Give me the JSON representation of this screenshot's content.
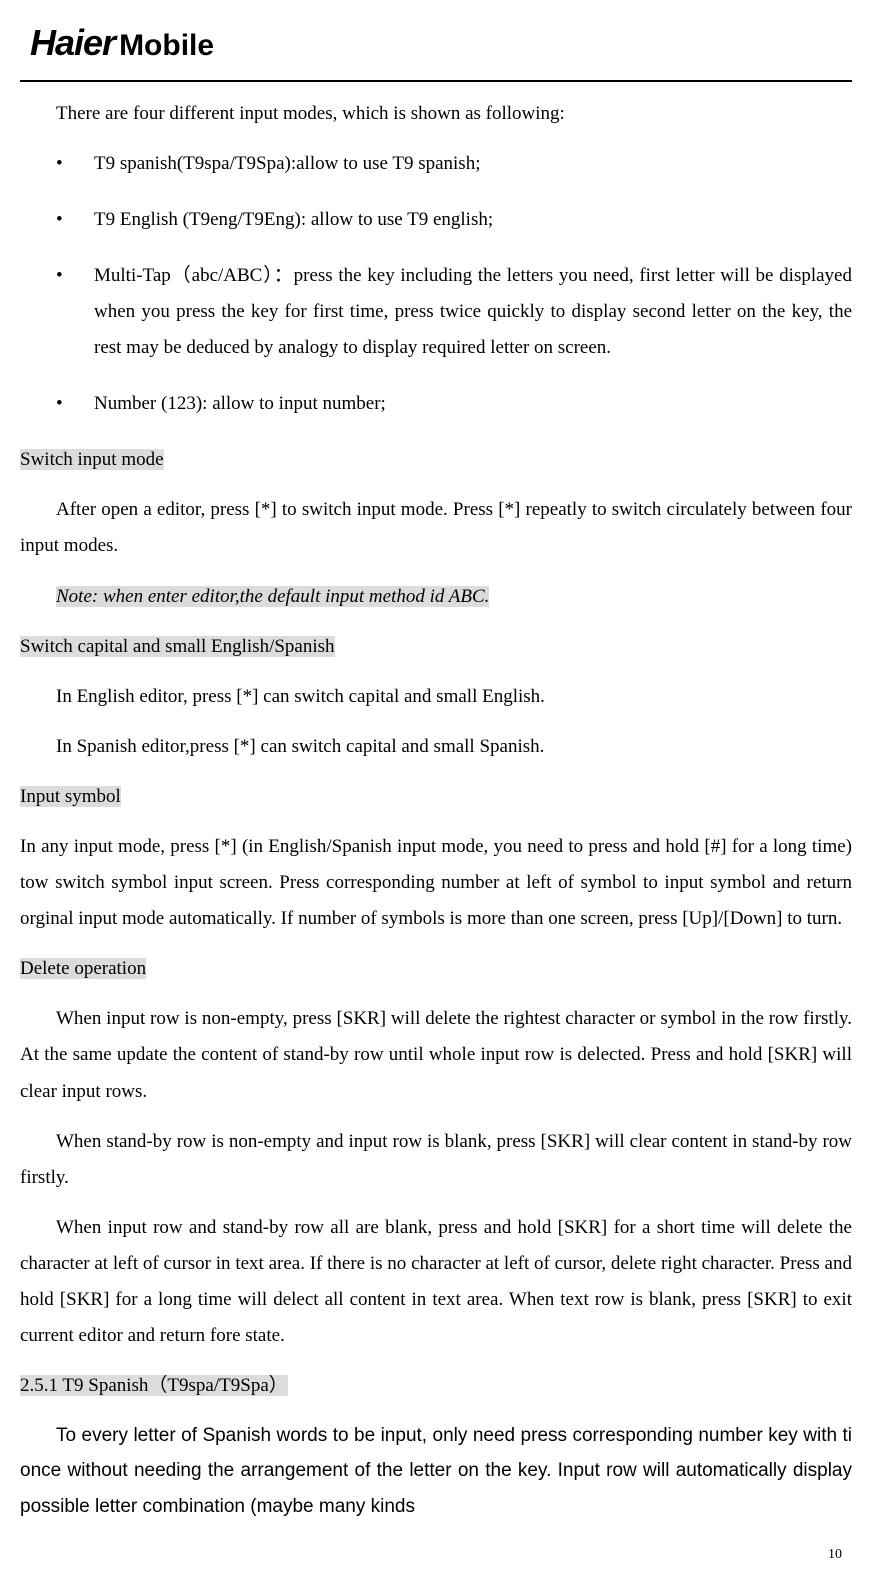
{
  "logo": {
    "brand": "Haier",
    "sub": "Mobile"
  },
  "intro": "There are four different input modes, which is shown as following:",
  "bullets": [
    " T9 spanish(T9spa/T9Spa):allow to use T9 spanish;",
    "T9 English (T9eng/T9Eng): allow to use T9 english;",
    "Multi-Tap（abc/ABC）：press the key including the letters you need, first letter will be displayed when you press the key for first time, press twice quickly to display second letter on the key, the rest may be deduced by analogy to display required letter on screen.",
    "Number (123): allow to input number;"
  ],
  "sections": {
    "switchInput": {
      "heading": "Switch input mode",
      "body": "After open a editor, press [*] to switch input mode. Press [*] repeatly to switch circulately between four input modes.",
      "note": "Note: when enter editor,the default input method id ABC."
    },
    "switchCapital": {
      "heading": "Switch capital and small English/Spanish",
      "p1": "In English editor, press [*] can switch capital and small English.",
      "p2": "In Spanish editor,press [*] can switch capital and small Spanish."
    },
    "inputSymbol": {
      "heading": "Input symbol",
      "body": "In any input mode, press [*] (in English/Spanish input mode, you need to press and hold [#] for a long time) tow switch symbol input screen. Press corresponding number at left of symbol to input symbol and return orginal input mode automatically. If number of symbols is more than one screen, press [Up]/[Down] to turn."
    },
    "deleteOp": {
      "heading": "Delete operation",
      "p1": "When input row is non-empty, press [SKR] will delete the rightest character or symbol in the row firstly. At the same update the content of stand-by row until whole input row is delected. Press and hold [SKR] will clear input rows.",
      "p2": "When stand-by row is non-empty and input row is blank, press [SKR] will clear content in stand-by row firstly.",
      "p3": "When input row and stand-by row all are blank, press and hold [SKR] for a short time will delete the character at left of cursor in text area. If there is no character at left of cursor, delete right character. Press and hold [SKR] for a long time will delect all content in text area. When text row is blank, press [SKR] to exit current editor and return fore state."
    },
    "t9spanish": {
      "heading": "2.5.1 T9 Spanish（T9spa/T9Spa）",
      "body": "To every letter of Spanish words to be input, only need press corresponding number key with ti once without needing the arrangement of the letter on the key. Input row will automatically display possible letter combination (maybe many kinds"
    }
  },
  "pageNumber": "10"
}
